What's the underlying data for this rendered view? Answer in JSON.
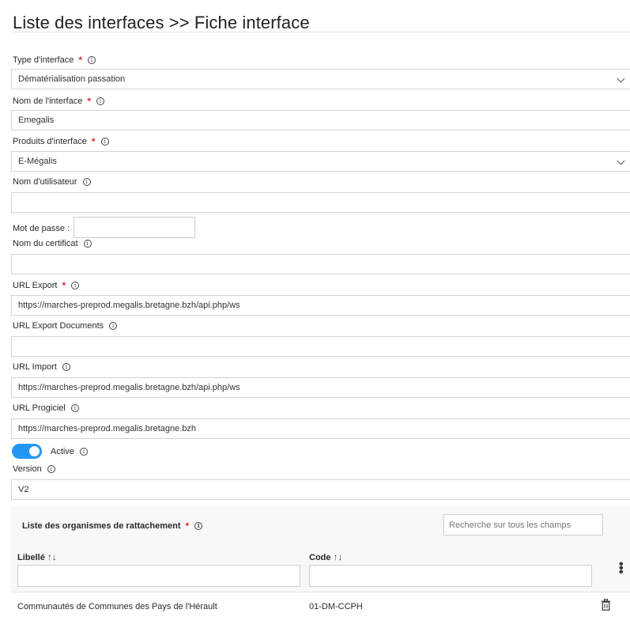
{
  "page": {
    "title": "Liste des interfaces >> Fiche interface"
  },
  "fields": {
    "type_interface": {
      "label": "Type d'interface",
      "value": "Dématérialisation passation"
    },
    "nom_interface": {
      "label": "Nom de l'interface",
      "value": "Emegalis"
    },
    "produits_interface": {
      "label": "Produits d'interface",
      "value": "E-Mégalis"
    },
    "nom_utilisateur": {
      "label": "Nom d'utilisateur",
      "value": ""
    },
    "mot_de_passe": {
      "label": "Mot de passe :",
      "value": ""
    },
    "nom_certificat": {
      "label": "Nom du certificat",
      "value": ""
    },
    "url_export": {
      "label": "URL Export",
      "value": "https://marches-preprod.megalis.bretagne.bzh/api.php/ws"
    },
    "url_export_documents": {
      "label": "URL Export Documents",
      "value": ""
    },
    "url_import": {
      "label": "URL Import",
      "value": "https://marches-preprod.megalis.bretagne.bzh/api.php/ws"
    },
    "url_progiciel": {
      "label": "URL Progiciel",
      "value": "https://marches-preprod.megalis.bretagne.bzh"
    },
    "active": {
      "label": "Active",
      "checked": true
    },
    "version": {
      "label": "Version",
      "value": "V2"
    }
  },
  "organismes": {
    "title": "Liste des organismes de rattachement",
    "search_placeholder": "Recherche sur tous les champs",
    "columns": [
      {
        "label": "Libellé",
        "sort_icon": "↑↓"
      },
      {
        "label": "Code",
        "sort_icon": "↑↓"
      }
    ],
    "rows": [
      {
        "libelle": "Communautés de Communes des Pays de l'Hérault",
        "code": "01-DM-CCPH"
      }
    ]
  },
  "symbols": {
    "required": "*",
    "info": "i",
    "kebab": "⋮"
  },
  "colors": {
    "accent": "#2196f3",
    "required": "#d32f2f"
  }
}
